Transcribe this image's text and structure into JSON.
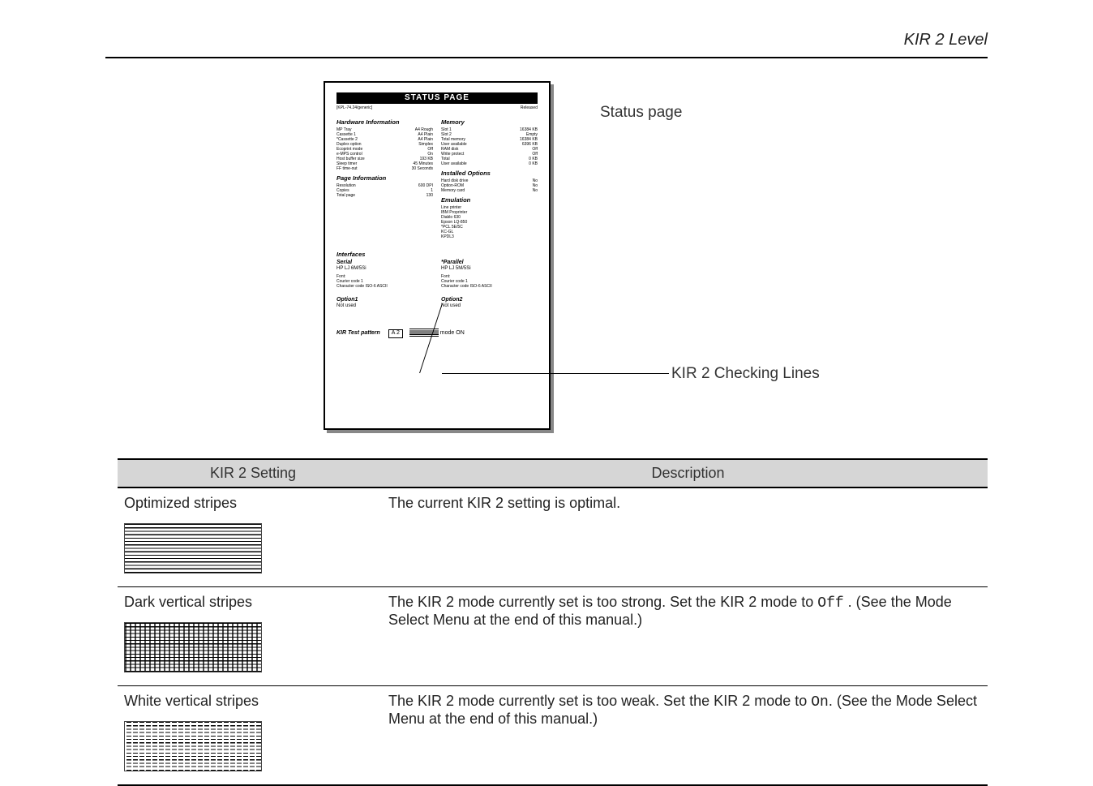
{
  "header": {
    "title": "KIR 2 Level"
  },
  "callouts": {
    "status_page_label": "Status page",
    "kir_lines_label": "KIR 2 Checking Lines"
  },
  "status_page": {
    "banner": "STATUS PAGE",
    "firmware_sub_left": "[KPL-74.24/generic]",
    "firmware_sub_mid": "",
    "firmware_sub_right": "Released",
    "hw_heading": "Hardware Information",
    "hw_rows": [
      {
        "k": "MP Tray",
        "v1": "A4",
        "v2": "Rough"
      },
      {
        "k": "Cassette 1",
        "v1": "A4",
        "v2": "Plain"
      },
      {
        "k": "*Cassette 2",
        "v1": "A4",
        "v2": "Plain"
      },
      {
        "k": "Duplex option",
        "v1": "Simplex",
        "v2": ""
      },
      {
        "k": "Ecoprint mode",
        "v1": "Off",
        "v2": ""
      },
      {
        "k": "e-MPS control",
        "v1": "On",
        "v2": ""
      },
      {
        "k": "Host buffer size",
        "v1": "193 KB",
        "v2": ""
      },
      {
        "k": "Sleep timer",
        "v1": "45 Minutes",
        "v2": ""
      },
      {
        "k": "FF time-out",
        "v1": "30 Seconds",
        "v2": ""
      }
    ],
    "page_heading": "Page Information",
    "page_rows": [
      {
        "k": "Resolution",
        "v": "600 DPI"
      },
      {
        "k": "Copies",
        "v": "1"
      },
      {
        "k": "Total page",
        "v": "130"
      }
    ],
    "mem_heading": "Memory",
    "mem_rows": [
      {
        "k": "Slot 1",
        "v": "16384 KB"
      },
      {
        "k": "Slot 2",
        "v": "Empty"
      },
      {
        "k": "Total memory",
        "v": "16384 KB"
      },
      {
        "k": "User available",
        "v": "6396 KB"
      },
      {
        "k": "RAM disk",
        "v": "Off"
      },
      {
        "k": "Write protect",
        "v": "Off"
      },
      {
        "k": "Total",
        "v": "0 KB"
      },
      {
        "k": "User available",
        "v": "0 KB"
      }
    ],
    "opt_heading": "Installed Options",
    "opt_rows": [
      {
        "k": "Hard disk drive",
        "v": "No"
      },
      {
        "k": "Option-ROM",
        "v": "No"
      },
      {
        "k": "Memory card",
        "v": "No"
      }
    ],
    "emu_heading": "Emulation",
    "emu_list": [
      "Line printer",
      "IBM Proprinter",
      "Diablo 630",
      "Epson LQ-850",
      "*PCL 5E/5C",
      "KC-GL",
      "KPDL3"
    ],
    "if_heading": "Interfaces",
    "serial": {
      "title": "Serial",
      "sub": "HP LJ 6M/5Si",
      "rows": [
        "Font:",
        "Courier code  1",
        "Character code  ISO-6 ASCII"
      ]
    },
    "parallel": {
      "title": "*Parallel",
      "sub": "HP LJ 5M/5Si",
      "rows": [
        "Font:",
        "Courier code  1",
        "Character code  ISO-6 ASCII"
      ]
    },
    "opt1": {
      "title": "Option1",
      "val": "Not used"
    },
    "opt2": {
      "title": "Option2",
      "val": "Not used"
    },
    "kir_test": {
      "label": "KIR  Test pattern",
      "lvl": "A  2",
      "mode": "mode   ON"
    }
  },
  "table": {
    "headers": {
      "setting": "KIR 2 Setting",
      "desc": "Description"
    },
    "rows": [
      {
        "setting": "Optimized stripes",
        "desc": "The current KIR 2 setting is optimal.",
        "swatch": "opt"
      },
      {
        "setting": "Dark vertical stripes",
        "desc_a": "The KIR 2 mode currently set is too strong. Set the KIR 2 mode to ",
        "code": "Off",
        "desc_b": " . (See the Mode Select Menu at the end of this manual.)",
        "swatch": "dark"
      },
      {
        "setting": "White vertical stripes",
        "desc_a": "The KIR 2 mode currently set is too weak. Set the KIR 2 mode to ",
        "code": "On",
        "desc_b": ". (See the Mode Select Menu at the end of this manual.)",
        "swatch": "white"
      }
    ]
  }
}
